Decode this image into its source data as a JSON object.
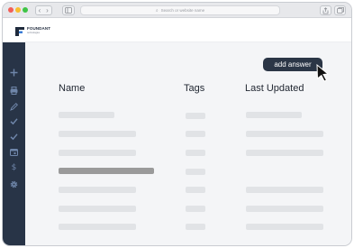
{
  "browser": {
    "url_placeholder": "Search or website name",
    "back_icon": "chevron-left-icon",
    "forward_icon": "chevron-right-icon"
  },
  "header": {
    "logo_title": "FOUNDANT",
    "logo_subtitle": "technologies"
  },
  "sidebar": {
    "items": [
      {
        "icon": "plus-icon"
      },
      {
        "icon": "printer-icon"
      },
      {
        "icon": "pencil-icon"
      },
      {
        "icon": "check-icon"
      },
      {
        "icon": "check-icon"
      },
      {
        "icon": "calendar-icon"
      },
      {
        "icon": "dollar-icon"
      },
      {
        "icon": "gear-icon"
      }
    ]
  },
  "toolbar": {
    "add_answer_label": "add answer"
  },
  "table": {
    "columns": [
      "Name",
      "Tags",
      "Last Updated"
    ],
    "rows_count_note_visible": false
  },
  "colors": {
    "sidebar_bg": "#283447",
    "button_bg": "#2b3646",
    "placeholder_bar": "#e1e3e6",
    "highlight_bar": "#9a9a9a"
  }
}
